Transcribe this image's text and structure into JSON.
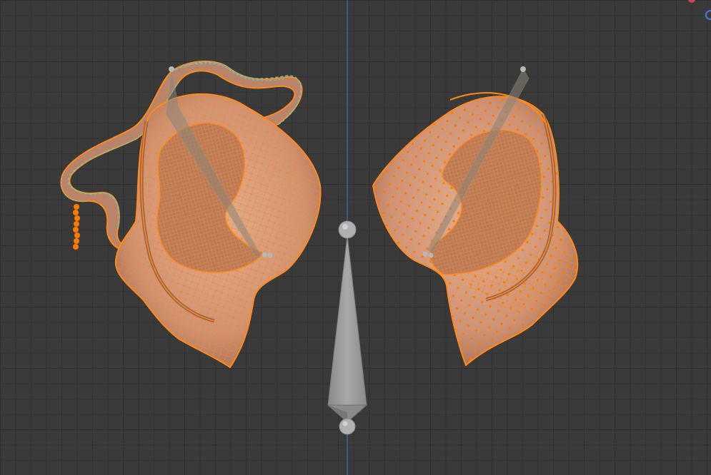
{
  "viewport": {
    "mode": "edit-mesh",
    "colors": {
      "background": "#3a3a3a",
      "grid_major": "#2f2f2f",
      "grid_minor": "#333333",
      "axis_line": "#3d6fb5",
      "mesh_fill": "#d49a7a",
      "mesh_shadow": "#a86e52",
      "selected_wire": "#ff8a1c",
      "selected_vertex": "#ff7a00",
      "seam_edges": "#3fd9e0",
      "bone": "#9a9a9a",
      "bone_joint": "#b8b8b8"
    },
    "objects": [
      {
        "name_icon": "left-ear-mesh-icon",
        "selection": "selected"
      },
      {
        "name_icon": "right-ear-mesh-icon",
        "selection": "selected"
      },
      {
        "name_icon": "center-bone-icon",
        "selection": "unselected"
      }
    ],
    "gizmo": {
      "icon": "navigation-gizmo-icon"
    }
  }
}
